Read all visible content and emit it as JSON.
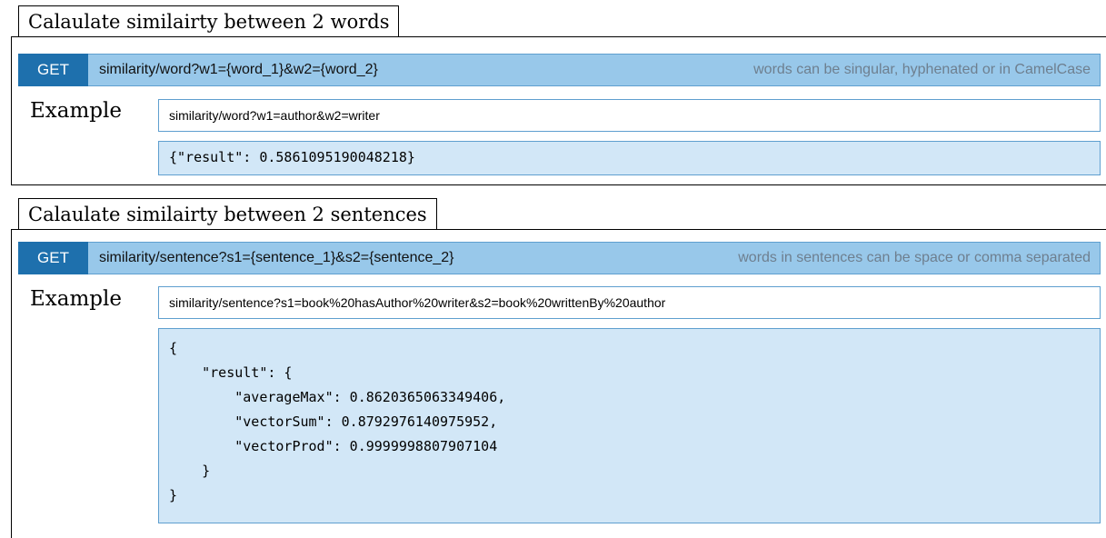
{
  "sections": [
    {
      "title": "Calaulate similairty between 2 words",
      "method": "GET",
      "path": "similarity/word?w1={word_1}&w2={word_2}",
      "note": "words can be singular, hyphenated or in CamelCase",
      "example_label": "Example",
      "example_request": "similarity/word?w1=author&w2=writer",
      "response_lines": [
        "{\"result\": 0.5861095190048218}"
      ]
    },
    {
      "title": "Calaulate similairty between 2 sentences",
      "method": "GET",
      "path": "similarity/sentence?s1={sentence_1}&s2={sentence_2}",
      "note": "words in sentences can be space or comma separated",
      "example_label": "Example",
      "example_request": "similarity/sentence?s1=book%20hasAuthor%20writer&s2=book%20writtenBy%20author",
      "response_lines": [
        "{",
        "    \"result\": {",
        "        \"averageMax\": 0.8620365063349406,",
        "        \"vectorSum\": 0.8792976140975952,",
        "        \"vectorProd\": 0.9999998807907104",
        "    }",
        "}"
      ]
    }
  ]
}
